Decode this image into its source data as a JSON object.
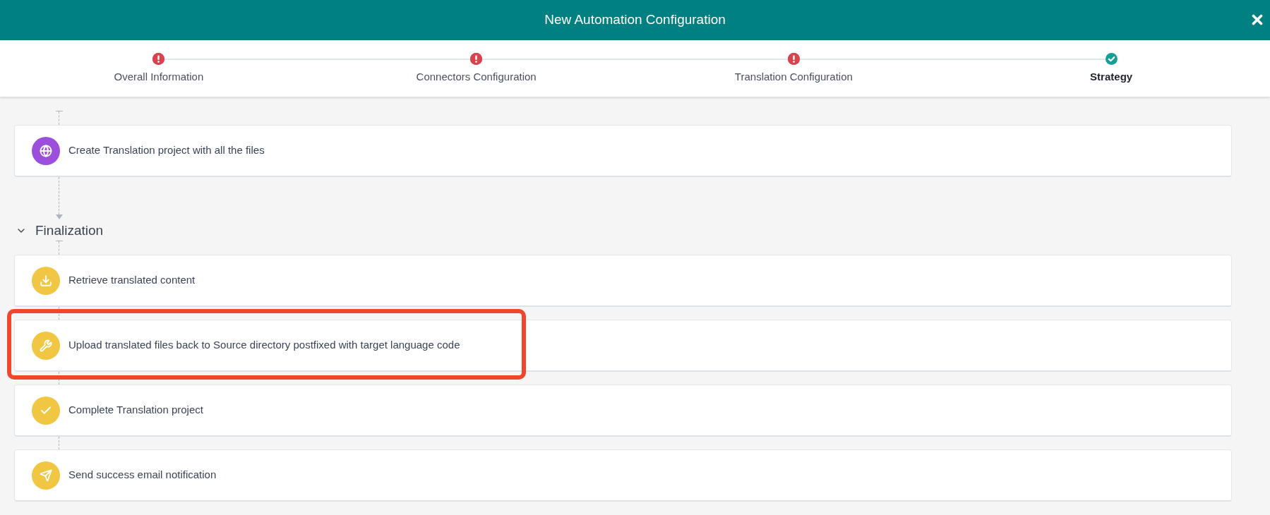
{
  "window": {
    "title": "New Automation Configuration"
  },
  "steps": [
    {
      "label": "Overall Information",
      "completed": false,
      "selected": false
    },
    {
      "label": "Connectors Configuration",
      "completed": false,
      "selected": false
    },
    {
      "label": "Translation Configuration",
      "completed": false,
      "selected": false
    },
    {
      "label": "Strategy",
      "completed": true,
      "selected": true
    }
  ],
  "sections": [
    {
      "tasks": [
        {
          "label": "Create Translation project with all the files",
          "kind": "globe",
          "color": "#9b4fdc",
          "highlighted": false
        }
      ]
    },
    {
      "title": "Finalization",
      "expanded": true,
      "tasks": [
        {
          "label": "Retrieve translated content",
          "kind": "download",
          "color": "#f0c642",
          "highlighted": false
        },
        {
          "label": "Upload translated files back to Source directory postfixed with target language code",
          "kind": "wrench",
          "color": "#f0c642",
          "highlighted": true
        },
        {
          "label": "Complete Translation project",
          "kind": "check",
          "color": "#f0c642",
          "highlighted": false
        },
        {
          "label": "Send success email notification",
          "kind": "send",
          "color": "#f0c642",
          "highlighted": false
        }
      ]
    }
  ]
}
